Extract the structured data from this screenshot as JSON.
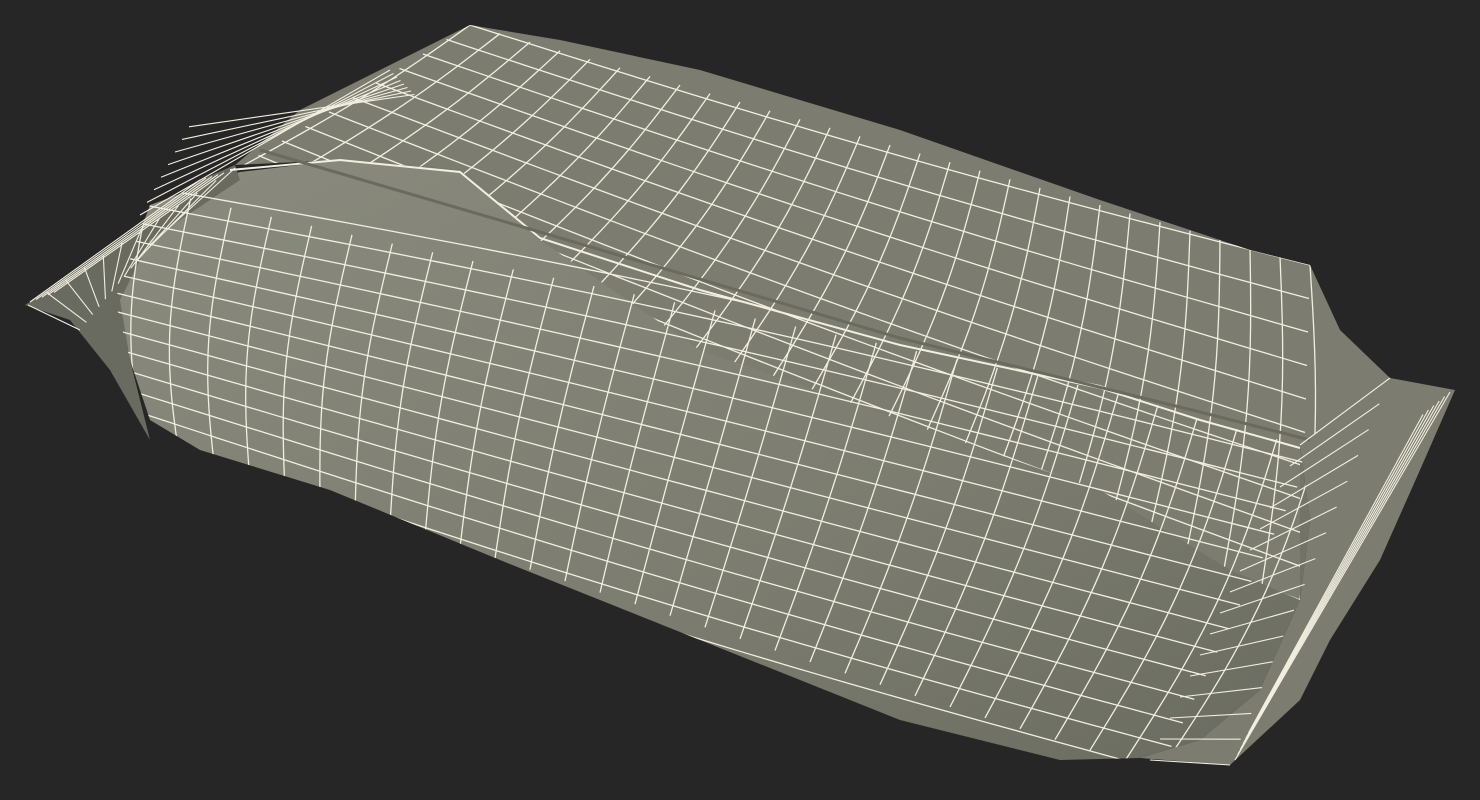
{
  "scene": {
    "background_color": "#262626",
    "mesh_fill_color": "#7c7d70",
    "mesh_shadow_color": "#6a6b60",
    "mesh_highlight_color": "#8a8b7e",
    "wireframe_color": "#f2efe0",
    "subject": "wireframe-package-mesh"
  }
}
